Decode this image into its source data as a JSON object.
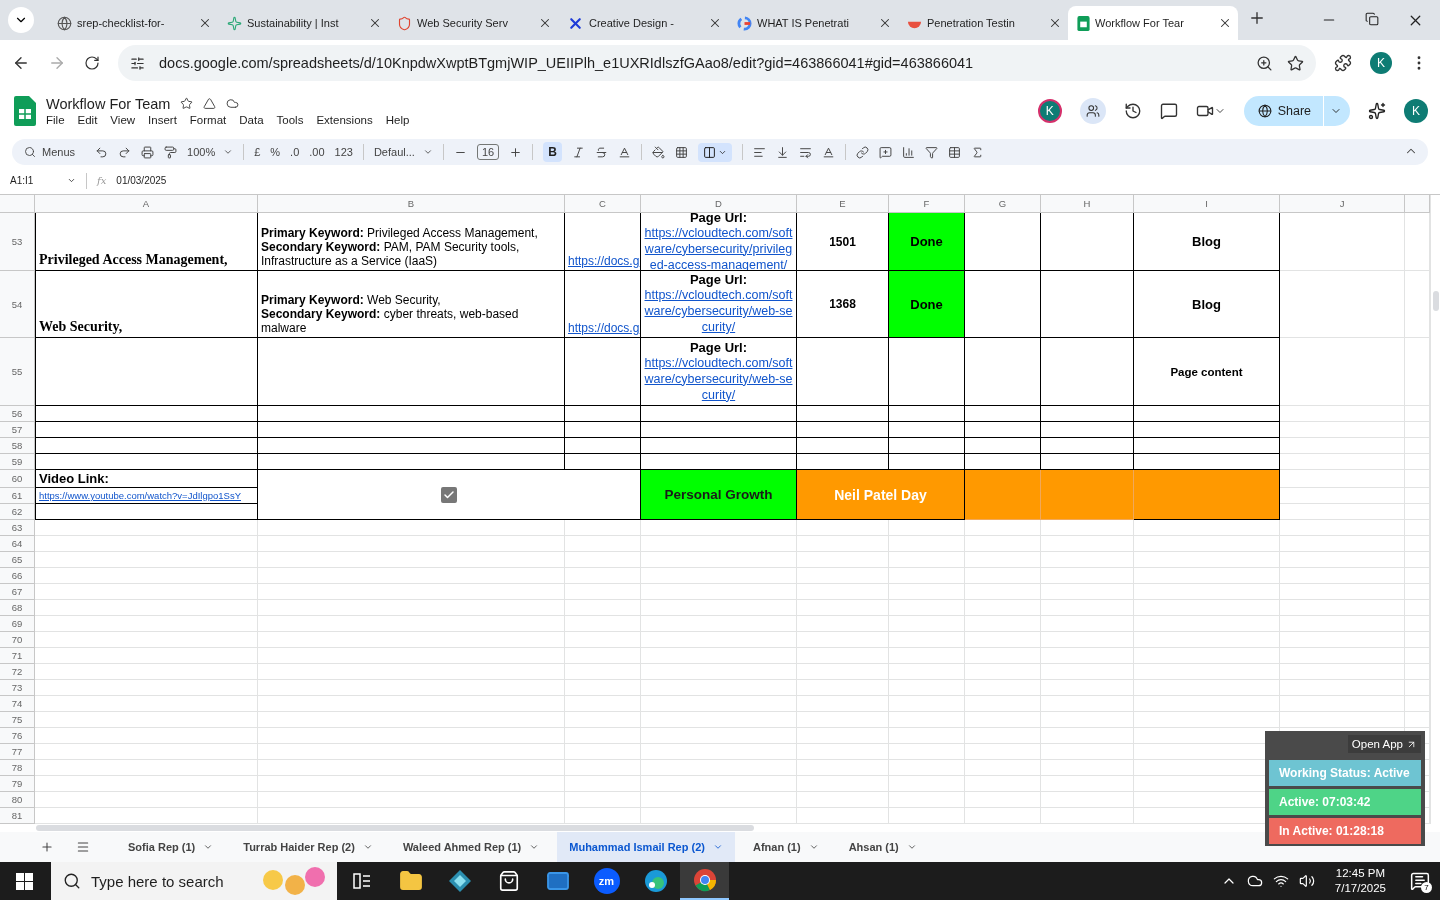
{
  "browser_tabs": [
    {
      "title": "srep-checklist-for-",
      "kind": "globe",
      "selected": false
    },
    {
      "title": "Sustainability | Inst",
      "kind": "sparkle",
      "selected": false
    },
    {
      "title": "Web Security Serv",
      "kind": "shield",
      "selected": false
    },
    {
      "title": "Creative Design -",
      "kind": "cross",
      "selected": false
    },
    {
      "title": "WHAT IS Penetrati",
      "kind": "ring",
      "selected": false
    },
    {
      "title": "Penetration Testin",
      "kind": "bowl",
      "selected": false
    },
    {
      "title": "Workflow For Tear",
      "kind": "sheet",
      "selected": true
    }
  ],
  "address": "docs.google.com/spreadsheets/d/10KnpdwXwptBTgmjWIP_UEIIPlh_e1UXRIdlszfGAao8/edit?gid=463866041#gid=463866041",
  "profile": "K",
  "doc": {
    "title": "Workflow For Team",
    "menus": [
      "File",
      "Edit",
      "View",
      "Insert",
      "Format",
      "Data",
      "Tools",
      "Extensions",
      "Help"
    ],
    "avatar": "K",
    "share": "Share",
    "account": "K"
  },
  "toolbar": {
    "search": "Menus",
    "zoom": "100%",
    "currency": "£",
    "percent": "%",
    "decimals_less": ".0",
    "decimals_more": ".00",
    "number_format": "123",
    "font": "Defaul...",
    "font_size": "16",
    "bold": {
      "label": "B",
      "selected": true
    },
    "merge": {
      "selected": true
    }
  },
  "formula_bar": {
    "name_box": "A1:I1",
    "symbol": "fx",
    "value": "01/03/2025"
  },
  "sheet": {
    "columns": [
      "A",
      "B",
      "C",
      "D",
      "E",
      "F",
      "G",
      "H",
      "I",
      "J"
    ],
    "row_numbers": [
      "53",
      "54",
      "55",
      "56",
      "57",
      "58",
      "59",
      "60",
      "61",
      "62",
      "63",
      "64",
      "65",
      "66",
      "67",
      "68",
      "69",
      "70",
      "71",
      "72",
      "73",
      "74",
      "75",
      "76",
      "77",
      "78",
      "79",
      "80",
      "81"
    ],
    "rows": [
      {
        "title": "Privileged Access Management,",
        "keywords": [
          "**Primary Keyword:** Privileged Access Management,",
          "**Secondary Keyword:** PAM, PAM Security tools, Infrastructure as a Service (IaaS)"
        ],
        "doc_link": "https://docs.g",
        "page_url": {
          "label": "Page Url:",
          "link": "https://vcloudtech.com/software/cybersecurity/privileged-access-management/"
        },
        "words": "1501",
        "status": "Done",
        "type": "Blog"
      },
      {
        "title": "Web Security,",
        "keywords": [
          "**Primary Keyword:** Web Security,",
          "**Secondary Keyword:** cyber threats, web-based malware"
        ],
        "doc_link": "https://docs.g",
        "page_url": {
          "label": "Page Url:",
          "link": "https://vcloudtech.com/software/cybersecurity/web-security/"
        },
        "words": "1368",
        "status": "Done",
        "type": "Blog"
      },
      {
        "page_url": {
          "label": "Page Url:",
          "link": "https://vcloudtech.com/software/cybersecurity/web-security/"
        },
        "type": "Page content"
      }
    ],
    "block": {
      "video_label": "Video Link:",
      "video_link": "https://www.youtube.com/watch?v=JdIlgpo1SsY",
      "checkbox": {
        "checked": true
      },
      "growth": "Personal Growth",
      "day": "Neil Patel Day"
    }
  },
  "sheet_tabs": [
    {
      "label": "Sofia Rep (1)",
      "selected": false
    },
    {
      "label": "Turrab Haider Rep (2)",
      "selected": false
    },
    {
      "label": "Waleed Ahmed Rep (1)",
      "selected": false
    },
    {
      "label": "Muhammad Ismail Rep (2)",
      "selected": true
    },
    {
      "label": "Afnan (1)",
      "selected": false
    },
    {
      "label": "Ahsan (1)",
      "selected": false
    }
  ],
  "widget": {
    "open_app": "Open App",
    "statuses": [
      {
        "text": "Working Status: Active",
        "color": "#6ec4d2"
      },
      {
        "text": "Active: 07:03:42",
        "color": "#4ed487"
      },
      {
        "text": "In Active: 01:28:18",
        "color": "#ee6a5f"
      }
    ]
  },
  "taskbar": {
    "search_placeholder": "Type here to search",
    "zoom_label": "zm",
    "time": "12:45 PM",
    "date": "7/17/2025",
    "notifications": "7"
  }
}
